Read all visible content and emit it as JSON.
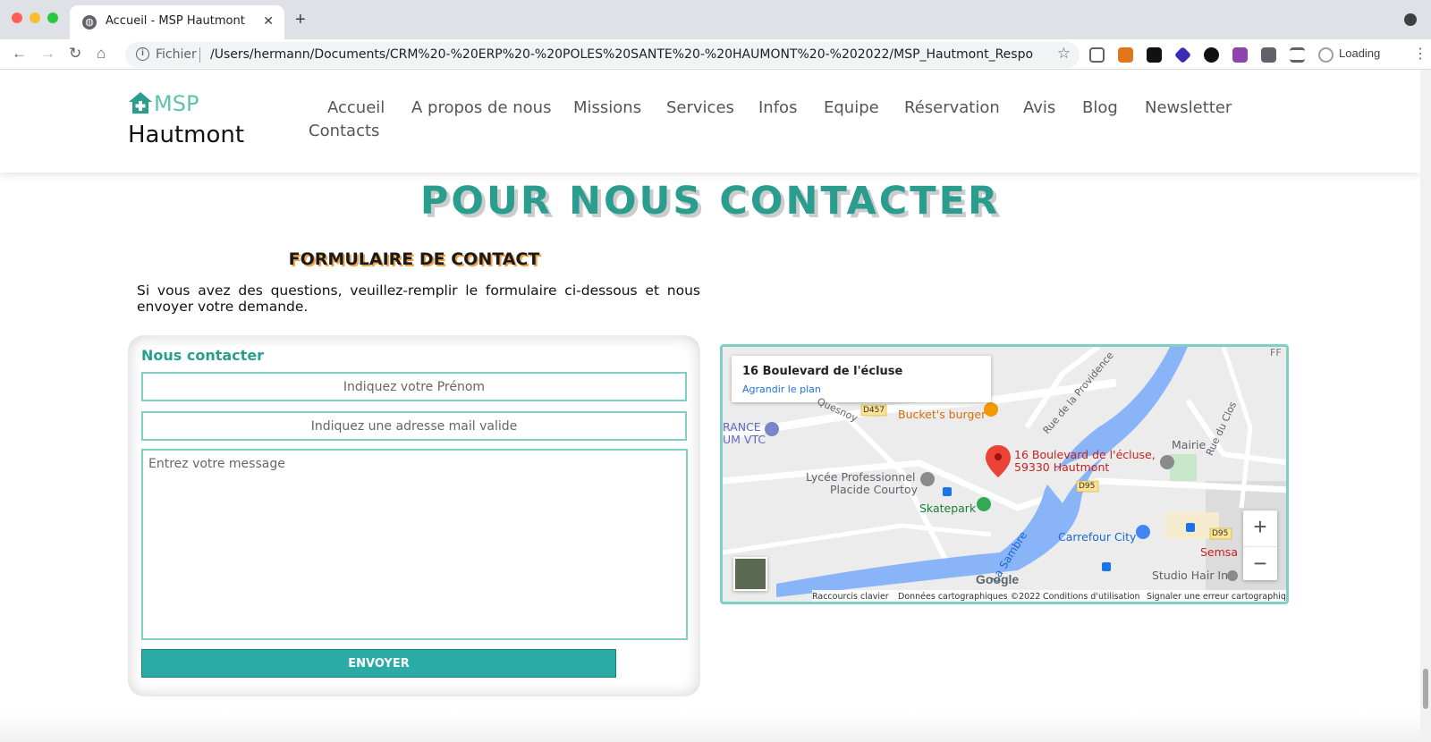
{
  "browser": {
    "tab_title": "Accueil - MSP Hautmont",
    "tab_close": "✕",
    "new_tab": "+",
    "url_scheme": "Fichier",
    "url": "/Users/hermann/Documents/CRM%20-%20ERP%20-%20POLES%20SANTE%20-%20HAUMONT%20-%202022/MSP_Hautmont_Responsive_Websi...",
    "loading_label": "Loading",
    "back": "←",
    "forward": "→",
    "reload": "↻",
    "home": "⌂",
    "star": "☆",
    "menu": "⋮"
  },
  "site": {
    "logo_short": "MSP",
    "logo_name": "Hautmont",
    "nav": [
      "Accueil",
      "A propos de nous",
      "Missions",
      "Services",
      "Infos",
      "Equipe",
      "Réservation",
      "Avis",
      "Blog",
      "Newsletter",
      "Contacts"
    ]
  },
  "contact": {
    "title": "POUR NOUS CONTACTER",
    "form_title": "FORMULAIRE DE CONTACT",
    "intro": "Si vous avez des questions, veuillez-remplir le formulaire ci-dessous et nous envoyer votre demande.",
    "form_heading": "Nous contacter",
    "firstname_placeholder": "Indiquez votre Prénom",
    "email_placeholder": "Indiquez une adresse mail valide",
    "message_placeholder": "Entrez votre message",
    "send_label": "ENVOYER"
  },
  "map": {
    "card_title": "16 Boulevard de l'écluse",
    "card_link": "Agrandir le plan",
    "pin_label_line1": "16 Boulevard de l'écluse,",
    "pin_label_line2": "59330 Hautmont",
    "places": {
      "burger": "Bucket's burger",
      "lycee_1": "Lycée Professionnel",
      "lycee_2": "Placide Courtoy",
      "skatepark": "Skatepark",
      "carrefour": "Carrefour City",
      "mairie": "Mairie",
      "studio": "Studio Hair In",
      "semsa": "Semsa",
      "rance_1": "RANCE",
      "rance_2": "UM VTC",
      "river": "La Sambre",
      "street_providence": "Rue de la Providence",
      "street_clos": "Rue du Clos",
      "street_quesnoy": "Quesnoy",
      "road_d457": "D457",
      "road_d95": "D95",
      "road_d95b": "D95",
      "corner_ff": "FF"
    },
    "zoom_in": "+",
    "zoom_out": "−",
    "google": "Google",
    "footer": [
      "Raccourcis clavier",
      "Données cartographiques ©2022",
      "Conditions d'utilisation",
      "Signaler une erreur cartographique"
    ],
    "colors": {
      "water": "#8ab4f8",
      "land": "#ececec",
      "road": "#ffffff",
      "pin": "#ea4335",
      "park": "#c8e6c9"
    }
  },
  "colors": {
    "accent": "#2a9d8f",
    "border": "#7ecfc4",
    "button": "#2aaba5",
    "logo": "#5ec3ad"
  }
}
